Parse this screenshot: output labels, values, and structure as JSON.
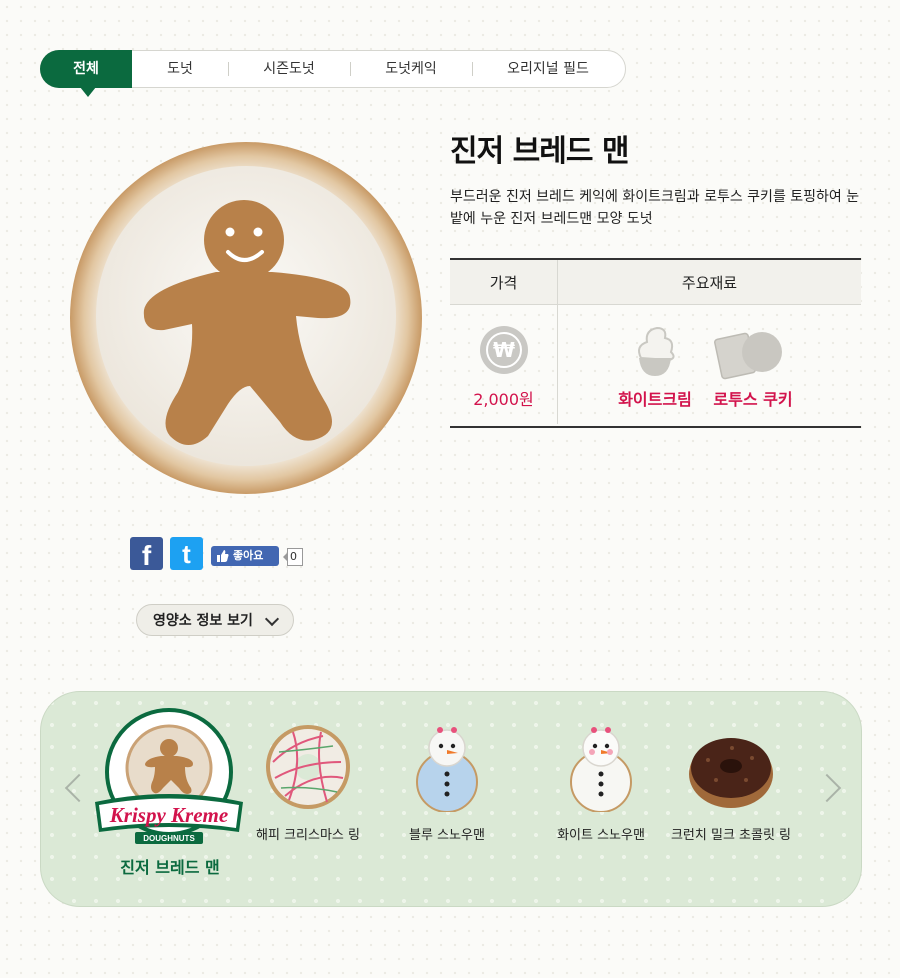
{
  "tabs": [
    "전체",
    "도넛",
    "시즌도넛",
    "도넛케익",
    "오리지널 필드"
  ],
  "product": {
    "name": "진저 브레드 맨",
    "description": "부드러운 진저 브레드 케익에 화이트크림과 로투스 쿠키를 토핑하여 눈밭에 누운 진저 브레드맨 모양 도넛"
  },
  "info_table": {
    "price_header": "가격",
    "ingredients_header": "주요재료",
    "won_symbol": "₩",
    "price": "2,000원",
    "ingredients": [
      {
        "name": "화이트크림",
        "icon": "whipped-cream-icon"
      },
      {
        "name": "로투스 쿠키",
        "icon": "cookie-icon"
      }
    ]
  },
  "social": {
    "facebook": "f",
    "twitter": "t",
    "like_label": "좋아요",
    "like_count": "0"
  },
  "nutrition_button": "영양소 정보 보기",
  "carousel": {
    "selected": {
      "name": "진저 브레드 맨",
      "logo_text": "Krispy Kreme",
      "logo_sub": "DOUGHNUTS"
    },
    "items": [
      {
        "name": "해피 크리스마스 링"
      },
      {
        "name": "블루 스노우맨"
      },
      {
        "name": "화이트 스노우맨"
      },
      {
        "name": "크런치 밀크 초콜릿 링"
      }
    ]
  },
  "colors": {
    "brand_green": "#0b6a3f",
    "accent_pink": "#d2134c"
  }
}
